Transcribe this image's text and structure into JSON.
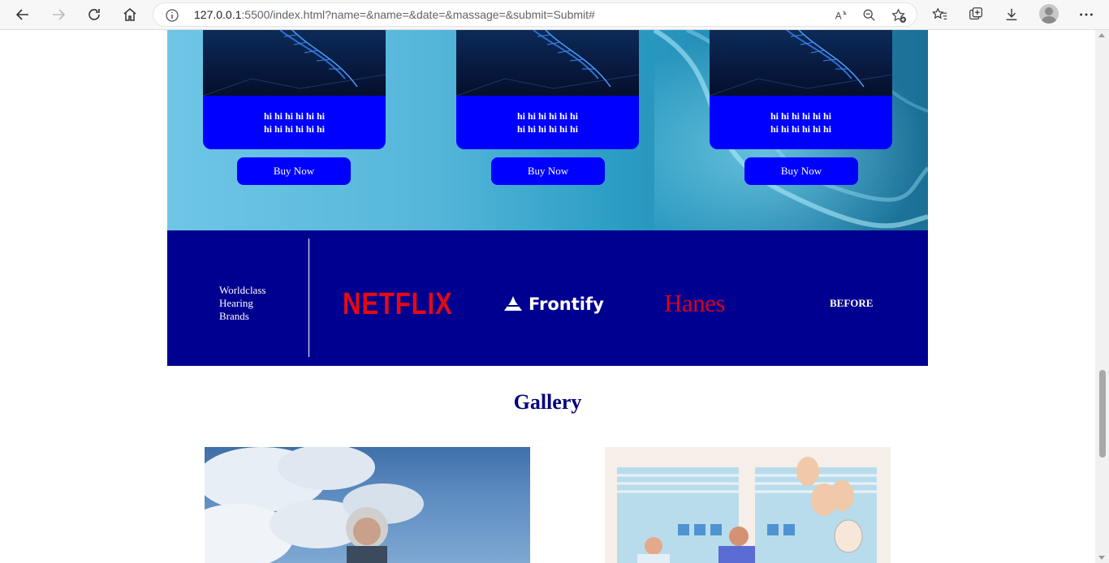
{
  "browser": {
    "url_host": "127.0.0.1",
    "url_rest": ":5500/index.html?name=&name=&date=&massage=&submit=Submit#"
  },
  "products": [
    {
      "line1": "hi hi hi hi hi hi",
      "line2": "hi hi hi hi hi hi",
      "button": "Buy Now"
    },
    {
      "line1": "hi hi hi hi hi hi",
      "line2": "hi hi hi hi hi hi",
      "button": "Buy Now"
    },
    {
      "line1": "hi hi hi hi hi hi",
      "line2": "hi hi hi hi hi hi",
      "button": "Buy Now"
    }
  ],
  "brands": {
    "title_lines": [
      "Worldclass",
      "Hearing",
      "Brands"
    ],
    "logos": [
      "NETFLIX",
      "Frontify",
      "Hanes",
      "BEFORE"
    ]
  },
  "gallery": {
    "title": "Gallery"
  },
  "colors": {
    "accent_blue": "#0000ff",
    "navy_band": "#000090",
    "gallery_title": "#000080",
    "netflix_red": "#e50914",
    "hanes_red": "#d5001c"
  },
  "icons": [
    "back-icon",
    "forward-icon",
    "refresh-icon",
    "home-icon",
    "info-icon",
    "read-aloud-icon",
    "zoom-icon",
    "add-favorite-icon",
    "favorites-icon",
    "collections-icon",
    "download-icon",
    "profile-icon",
    "more-icon"
  ]
}
